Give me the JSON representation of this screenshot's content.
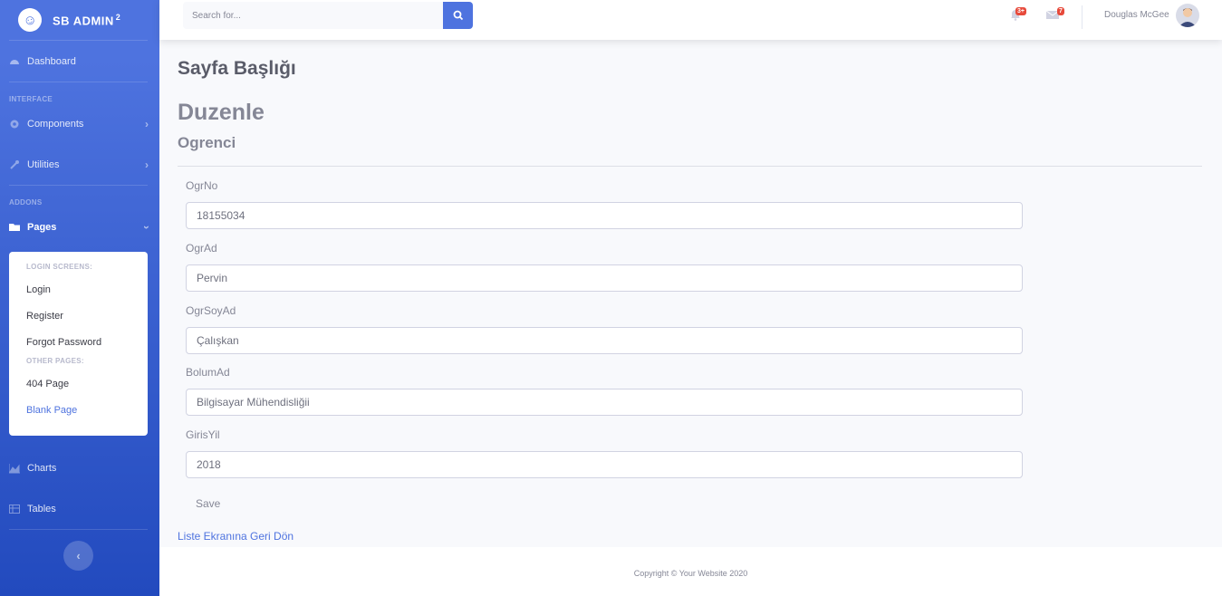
{
  "brand": {
    "name": "SB ADMIN",
    "sup": "2",
    "logo_glyph": "☺"
  },
  "sidebar": {
    "dashboard": "Dashboard",
    "heading_interface": "INTERFACE",
    "components": "Components",
    "utilities": "Utilities",
    "heading_addons": "ADDONS",
    "pages": "Pages",
    "collapse": {
      "header_login": "LOGIN SCREENS:",
      "login": "Login",
      "register": "Register",
      "forgot": "Forgot Password",
      "header_other": "OTHER PAGES:",
      "page404": "404 Page",
      "blank": "Blank Page"
    },
    "charts": "Charts",
    "tables": "Tables",
    "toggle_glyph": "‹"
  },
  "topbar": {
    "search_placeholder": "Search for...",
    "alerts_count": "3+",
    "messages_count": "7",
    "user_name": "Douglas McGee"
  },
  "main": {
    "page_title": "Sayfa Başlığı",
    "heading": "Duzenle",
    "subheading": "Ogrenci",
    "fields": [
      {
        "label": "OgrNo",
        "value": "18155034"
      },
      {
        "label": "OgrAd",
        "value": "Pervin"
      },
      {
        "label": "OgrSoyAd",
        "value": "Çalışkan"
      },
      {
        "label": "BolumAd",
        "value": "Bilgisayar Mühendisliğii"
      },
      {
        "label": "GirisYil",
        "value": "2018"
      }
    ],
    "save_label": "Save",
    "back_link": "Liste Ekranına Geri Dön"
  },
  "footer": {
    "copyright": "Copyright © Your Website 2020"
  },
  "colors": {
    "primary": "#4e73df",
    "danger": "#e74a3b",
    "text": "#858796"
  },
  "icons": [
    "laugh-wink-icon",
    "tachometer-icon",
    "cog-icon",
    "wrench-icon",
    "folder-icon",
    "chart-area-icon",
    "table-icon",
    "search-icon",
    "bell-icon",
    "envelope-icon",
    "user-avatar-icon"
  ]
}
